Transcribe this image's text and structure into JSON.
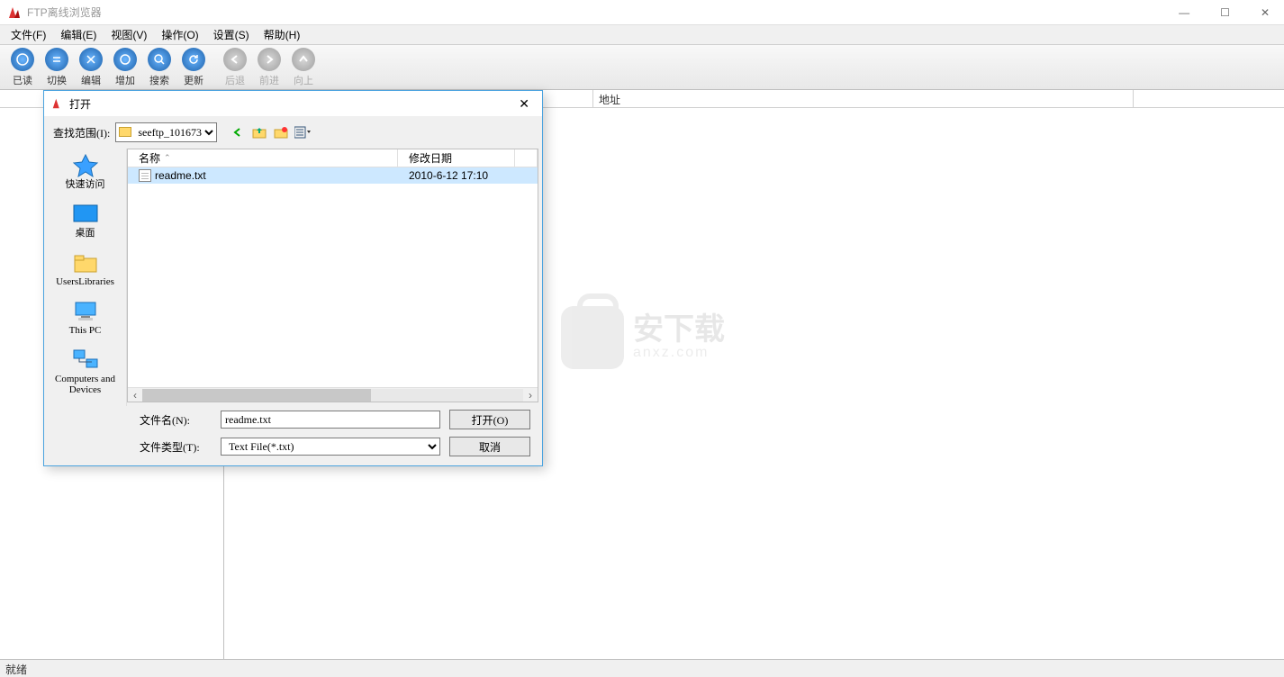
{
  "app": {
    "title": "FTP离线浏览器"
  },
  "menu": {
    "file": "文件(F)",
    "edit": "编辑(E)",
    "view": "视图(V)",
    "operate": "操作(O)",
    "settings": "设置(S)",
    "help": "帮助(H)"
  },
  "toolbar": {
    "read": "已读",
    "switch": "切换",
    "edit": "编辑",
    "add": "增加",
    "search": "搜索",
    "refresh": "更新",
    "back": "后退",
    "forward": "前进",
    "up": "向上"
  },
  "columns": {
    "address": "地址"
  },
  "status": "就绪",
  "watermark": {
    "brand": "安下载",
    "domain": "anxz.com"
  },
  "dialog": {
    "title": "打开",
    "lookin_label": "查找范围(I):",
    "lookin_value": "seeftp_101673",
    "places": {
      "quick": "快速访问",
      "desktop": "桌面",
      "libraries": "UsersLibraries",
      "thispc": "This PC",
      "computers": "Computers and Devices"
    },
    "headers": {
      "name": "名称",
      "date": "修改日期"
    },
    "files": [
      {
        "name": "readme.txt",
        "date": "2010-6-12 17:10"
      }
    ],
    "filename_label": "文件名(N):",
    "filename_value": "readme.txt",
    "filetype_label": "文件类型(T):",
    "filetype_value": "Text File(*.txt)",
    "open_btn": "打开(O)",
    "cancel_btn": "取消"
  }
}
